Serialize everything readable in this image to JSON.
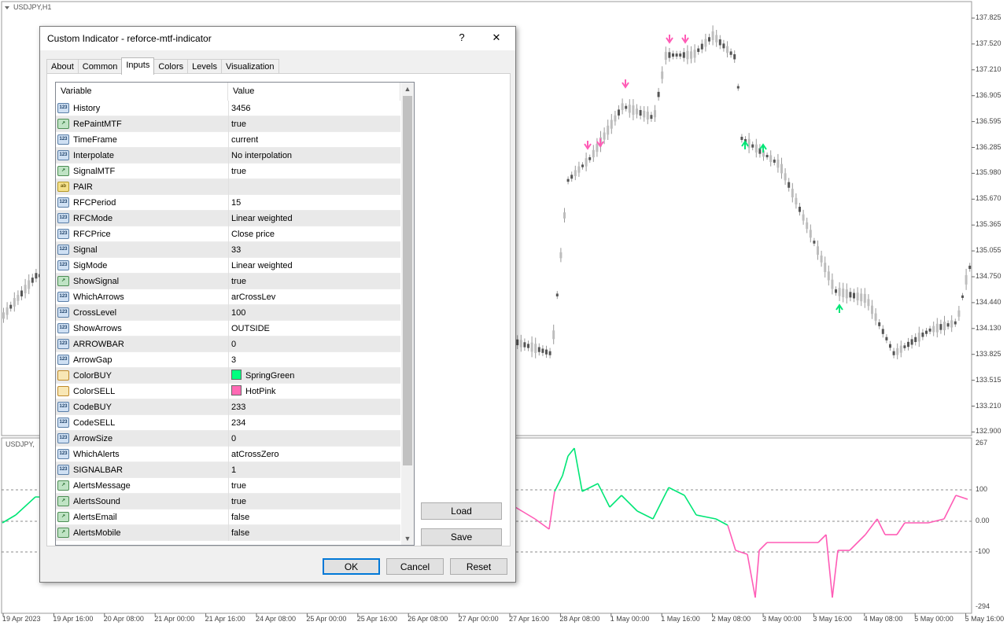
{
  "chart": {
    "symbol_top": "USDJPY,H1",
    "symbol_sub": "USDJPY,",
    "price_labels": [
      "137.825",
      "137.520",
      "137.210",
      "136.905",
      "136.595",
      "136.285",
      "135.980",
      "135.670",
      "135.365",
      "135.055",
      "134.750",
      "134.440",
      "134.130",
      "133.825",
      "133.515",
      "133.210",
      "132.900"
    ],
    "sub_labels": [
      "267",
      "100",
      "0.00",
      "-100",
      "-294"
    ],
    "time_labels": [
      "19 Apr 2023",
      "19 Apr 16:00",
      "20 Apr 08:00",
      "21 Apr 00:00",
      "21 Apr 16:00",
      "24 Apr 08:00",
      "25 Apr 00:00",
      "25 Apr 16:00",
      "26 Apr 08:00",
      "27 Apr 00:00",
      "27 Apr 16:00",
      "28 Apr 08:00",
      "1 May 00:00",
      "1 May 16:00",
      "2 May 08:00",
      "3 May 00:00",
      "3 May 16:00",
      "4 May 08:00",
      "5 May 00:00",
      "5 May 16:00"
    ],
    "colors": {
      "buy": "#00e676",
      "sell": "#ff5cb6",
      "candle": "#555555"
    }
  },
  "dialog": {
    "title": "Custom Indicator - reforce-mtf-indicator",
    "help_label": "?",
    "close_label": "✕",
    "tabs": [
      "About",
      "Common",
      "Inputs",
      "Colors",
      "Levels",
      "Visualization"
    ],
    "active_tab": "Inputs",
    "columns": {
      "variable": "Variable",
      "value": "Value"
    },
    "params": [
      {
        "name": "History",
        "value": "3456",
        "type": "int"
      },
      {
        "name": "RePaintMTF",
        "value": "true",
        "type": "bool"
      },
      {
        "name": "TimeFrame",
        "value": "current",
        "type": "int"
      },
      {
        "name": "Interpolate",
        "value": "No interpolation",
        "type": "int"
      },
      {
        "name": "SignalMTF",
        "value": "true",
        "type": "bool"
      },
      {
        "name": "PAIR",
        "value": "",
        "type": "str"
      },
      {
        "name": "RFCPeriod",
        "value": "15",
        "type": "int"
      },
      {
        "name": "RFCMode",
        "value": "Linear weighted",
        "type": "int"
      },
      {
        "name": "RFCPrice",
        "value": "Close price",
        "type": "int"
      },
      {
        "name": "Signal",
        "value": "33",
        "type": "int"
      },
      {
        "name": "SigMode",
        "value": "Linear weighted",
        "type": "int"
      },
      {
        "name": "ShowSignal",
        "value": "true",
        "type": "bool"
      },
      {
        "name": "WhichArrows",
        "value": "arCrossLev",
        "type": "int"
      },
      {
        "name": "CrossLevel",
        "value": "100",
        "type": "int"
      },
      {
        "name": "ShowArrows",
        "value": "OUTSIDE",
        "type": "int"
      },
      {
        "name": "ARROWBAR",
        "value": "0",
        "type": "int"
      },
      {
        "name": "ArrowGap",
        "value": "3",
        "type": "int"
      },
      {
        "name": "ColorBUY",
        "value": "SpringGreen",
        "type": "color",
        "swatch": "#00ff7f"
      },
      {
        "name": "ColorSELL",
        "value": "HotPink",
        "type": "color",
        "swatch": "#ff69b4"
      },
      {
        "name": "CodeBUY",
        "value": "233",
        "type": "int"
      },
      {
        "name": "CodeSELL",
        "value": "234",
        "type": "int"
      },
      {
        "name": "ArrowSize",
        "value": "0",
        "type": "int"
      },
      {
        "name": "WhichAlerts",
        "value": "atCrossZero",
        "type": "int"
      },
      {
        "name": "SIGNALBAR",
        "value": "1",
        "type": "int"
      },
      {
        "name": "AlertsMessage",
        "value": "true",
        "type": "bool"
      },
      {
        "name": "AlertsSound",
        "value": "true",
        "type": "bool"
      },
      {
        "name": "AlertsEmail",
        "value": "false",
        "type": "bool"
      },
      {
        "name": "AlertsMobile",
        "value": "false",
        "type": "bool"
      }
    ],
    "icon_text": {
      "int": "123",
      "bool": "↗",
      "str": "ab",
      "color": ""
    },
    "buttons": {
      "load": "Load",
      "save": "Save",
      "ok": "OK",
      "cancel": "Cancel",
      "reset": "Reset"
    }
  }
}
